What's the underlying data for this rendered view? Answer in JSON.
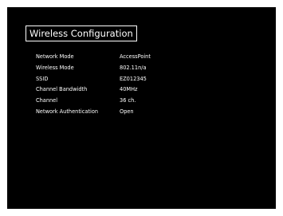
{
  "title": "Wireless Configuration",
  "settings": [
    {
      "label": "Network Mode",
      "value": "AccessPoint"
    },
    {
      "label": "Wireless Mode",
      "value": "802.11n/a"
    },
    {
      "label": "SSID",
      "value": "EZ012345"
    },
    {
      "label": "Channel Bandwidth",
      "value": "40MHz"
    },
    {
      "label": "Channel",
      "value": "36 ch."
    },
    {
      "label": "Network Authentication",
      "value": "Open"
    }
  ],
  "colors": {
    "background": "#000000",
    "text": "#ffffff",
    "frame": "#ffffff"
  }
}
